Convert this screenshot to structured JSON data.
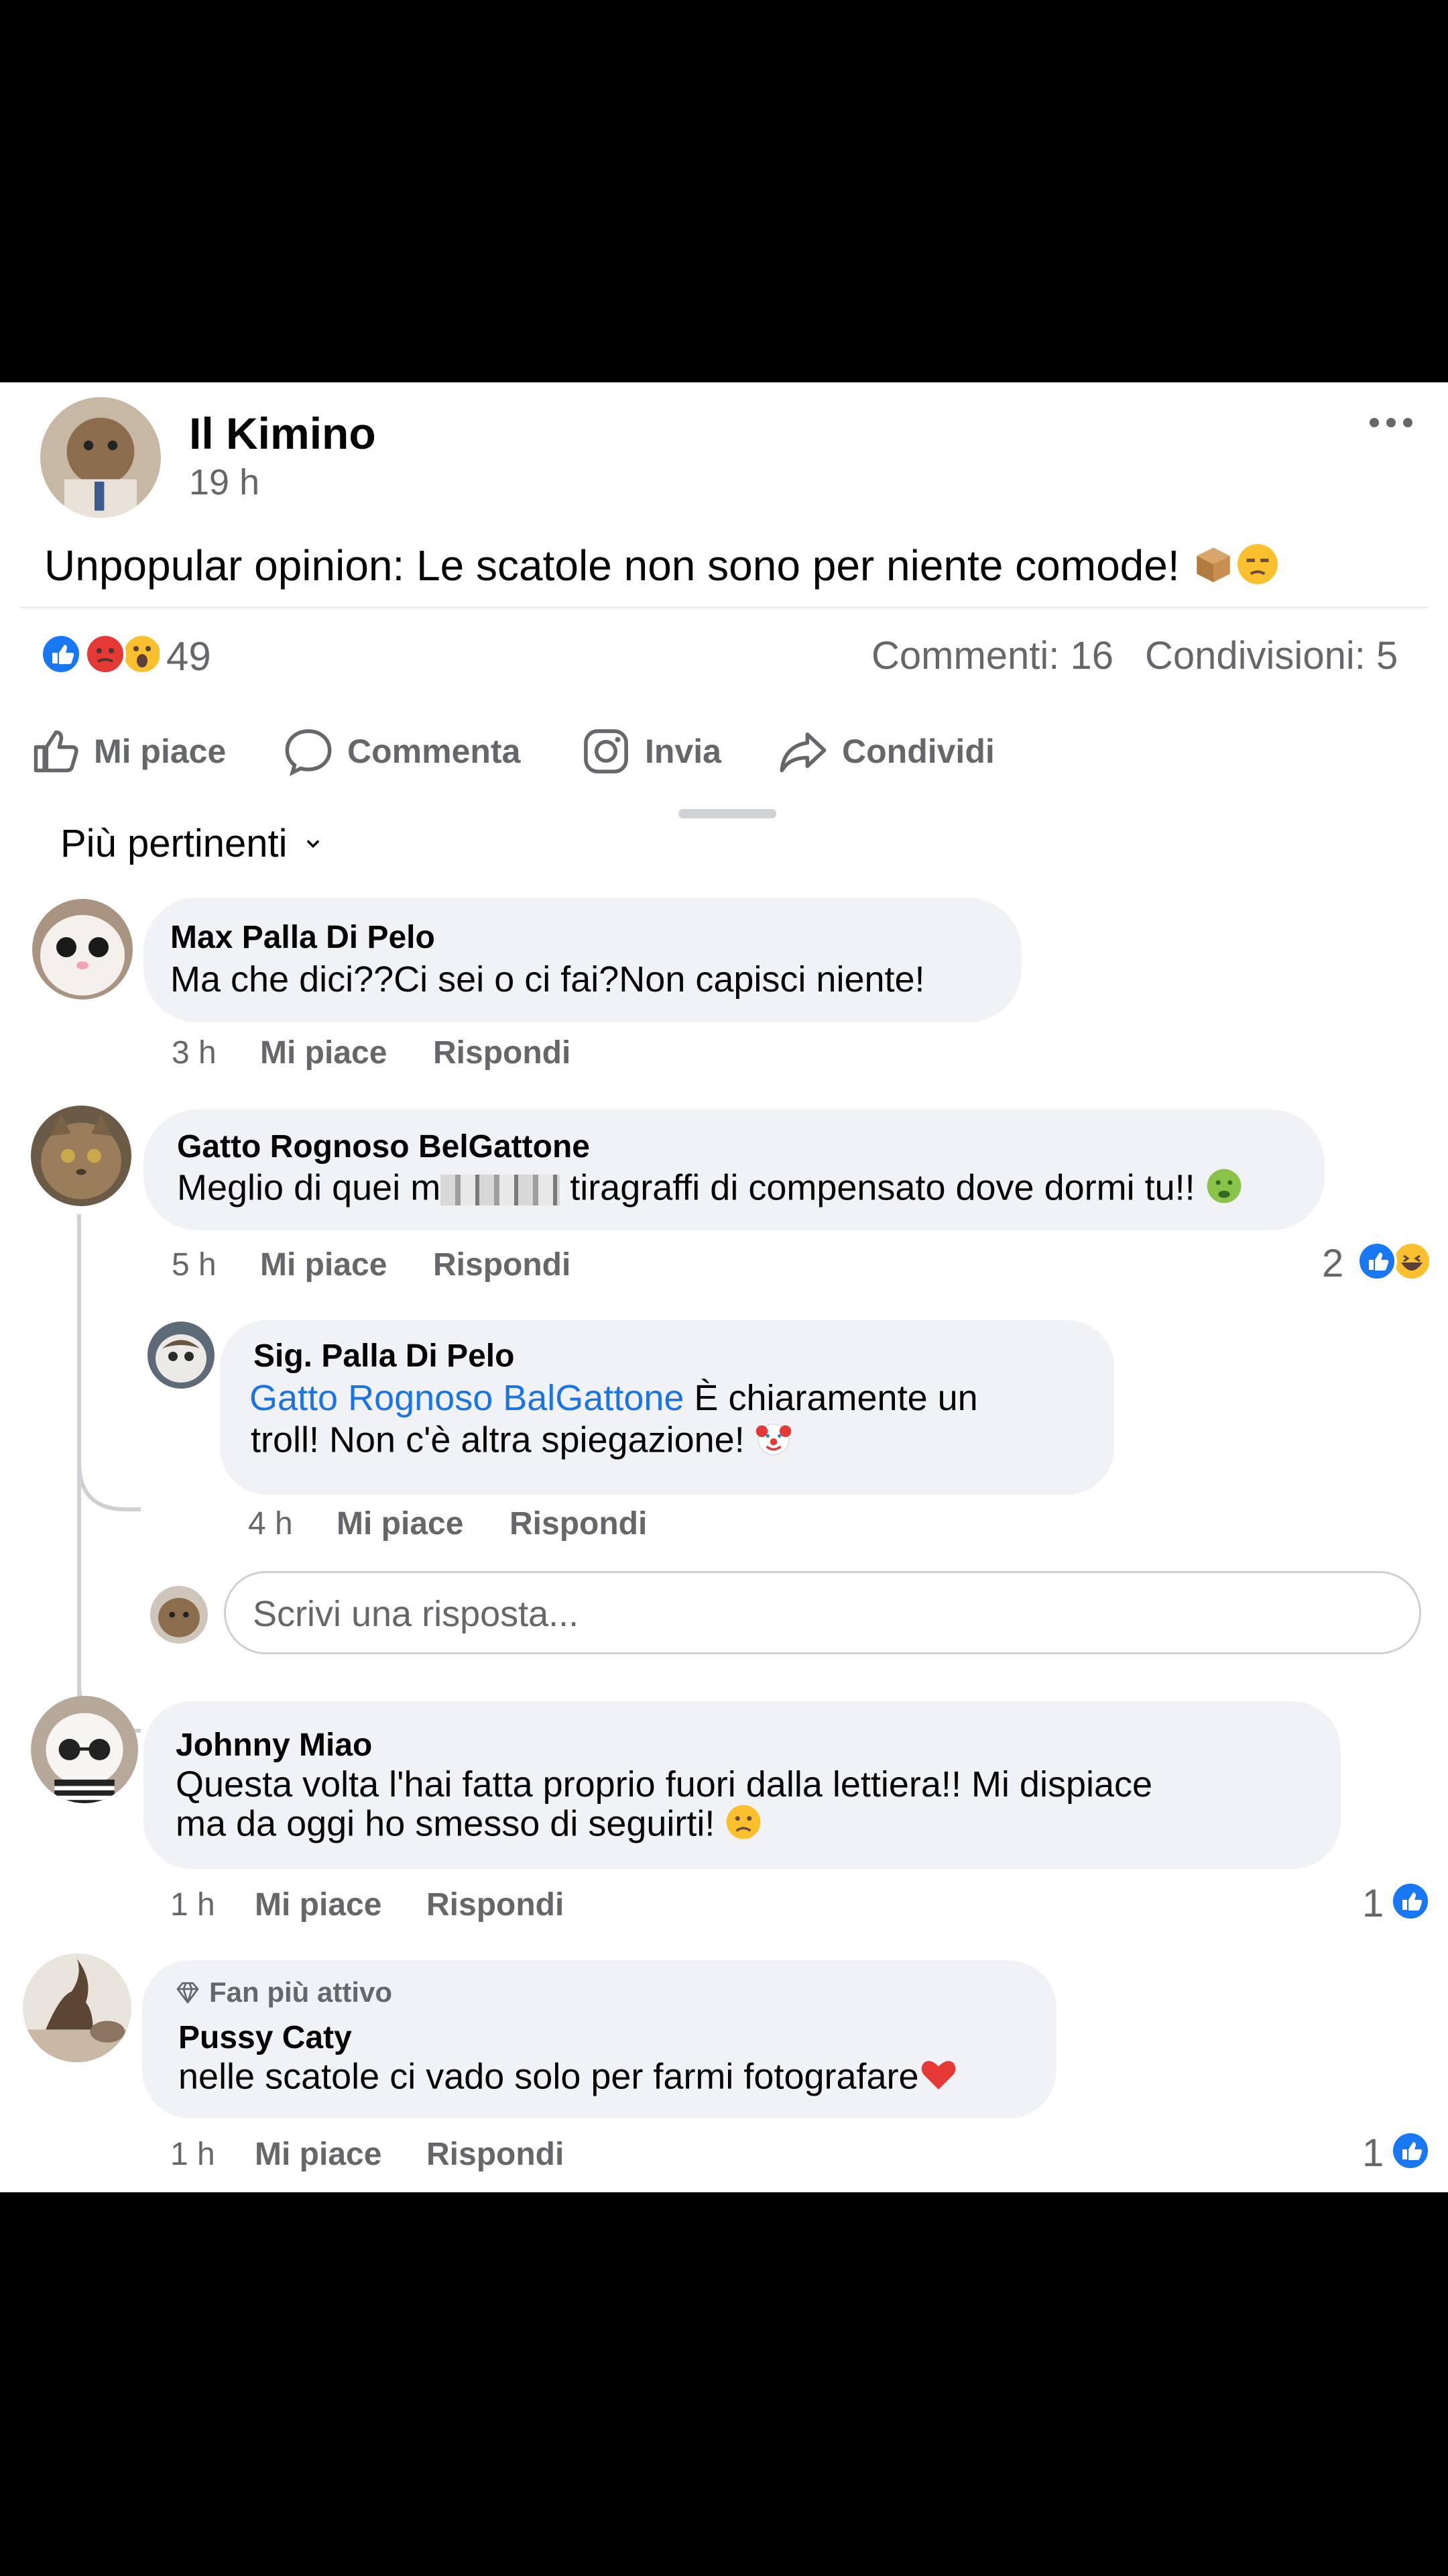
{
  "post": {
    "author": "Il Kimino",
    "time": "19 h",
    "text": "Unpopular opinion: Le scatole non sono per niente comode!",
    "reactions_count": "49",
    "comments_count": "Commenti: 16",
    "shares_count": "Condivisioni: 5"
  },
  "actions": {
    "like": "Mi piace",
    "comment": "Commenta",
    "send": "Invia",
    "share": "Condividi"
  },
  "sort": {
    "label": "Più pertinenti"
  },
  "comments": [
    {
      "author": "Max Palla Di Pelo",
      "text": "Ma che dici??Ci sei o ci fai?Non capisci niente!",
      "time": "3 h",
      "like": "Mi piace",
      "reply": "Rispondi"
    },
    {
      "author": "Gatto Rognoso BelGattone",
      "text_before": "Meglio di quei m",
      "text_after": " tiragraffi di compensato dove dormi tu!!",
      "time": "5 h",
      "like": "Mi piace",
      "reply": "Rispondi",
      "reaction_count": "2"
    },
    {
      "author": "Johnny Miao",
      "text_line1": "Questa volta l'hai fatta proprio fuori dalla lettiera!! Mi dispiace",
      "text_line2": "ma da oggi ho smesso di seguirti!",
      "time": "1 h",
      "like": "Mi piace",
      "reply": "Rispondi",
      "reaction_count": "1"
    },
    {
      "badge": "Fan più attivo",
      "author": "Pussy Caty",
      "text": "nelle scatole ci vado solo per farmi fotografare",
      "time": "1 h",
      "like": "Mi piace",
      "reply": "Rispondi",
      "reaction_count": "1"
    }
  ],
  "reply": {
    "author": "Sig. Palla Di Pelo",
    "mention": "Gatto Rognoso BalGattone",
    "text_line1": " È chiaramente un",
    "text_line2": "troll! Non c'è altra spiegazione!",
    "time": "4 h",
    "like": "Mi piace",
    "reply": "Rispondi"
  },
  "reply_input": {
    "placeholder": "Scrivi una risposta..."
  },
  "colors": {
    "link": "#1b74e4",
    "like_blue": "#1877f2",
    "muted": "#65676b",
    "bubble": "#f0f2f5"
  }
}
